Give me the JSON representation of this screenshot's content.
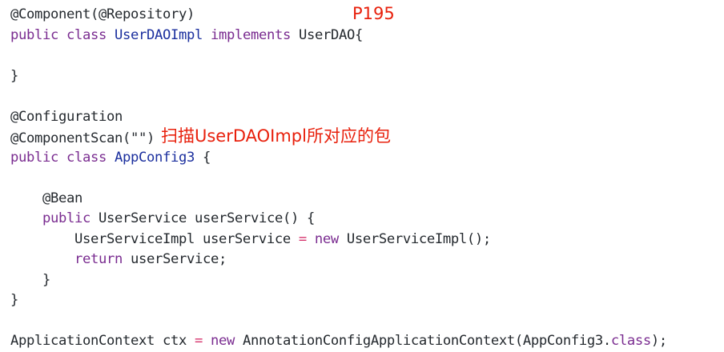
{
  "page_label": "P195",
  "annotation": "扫描UserDAOImpl所对应的包",
  "colors": {
    "plain": "#24292e",
    "keyword": "#7a2c90",
    "type": "#1b2f9e",
    "operator": "#d6336c",
    "annotation_text": "#e8200c",
    "string": "#24292e"
  },
  "lines": [
    [
      {
        "t": "@Component(@Repository)",
        "k": "plain"
      }
    ],
    [
      {
        "t": "public",
        "k": "keyword"
      },
      {
        "t": " ",
        "k": "plain"
      },
      {
        "t": "class",
        "k": "keyword"
      },
      {
        "t": " ",
        "k": "plain"
      },
      {
        "t": "UserDAOImpl",
        "k": "type"
      },
      {
        "t": " ",
        "k": "plain"
      },
      {
        "t": "implements",
        "k": "keyword"
      },
      {
        "t": " UserDAO{",
        "k": "plain"
      }
    ],
    [],
    [
      {
        "t": "}",
        "k": "plain"
      }
    ],
    [],
    [
      {
        "t": "@Configuration",
        "k": "plain"
      }
    ],
    [
      {
        "t": "@ComponentScan(",
        "k": "plain"
      },
      {
        "t": "\"\"",
        "k": "plain"
      },
      {
        "t": ")",
        "k": "plain"
      }
    ],
    [
      {
        "t": "public",
        "k": "keyword"
      },
      {
        "t": " ",
        "k": "plain"
      },
      {
        "t": "class",
        "k": "keyword"
      },
      {
        "t": " ",
        "k": "plain"
      },
      {
        "t": "AppConfig3",
        "k": "type"
      },
      {
        "t": " {",
        "k": "plain"
      }
    ],
    [],
    [
      {
        "t": "    @Bean",
        "k": "plain"
      }
    ],
    [
      {
        "t": "    ",
        "k": "plain"
      },
      {
        "t": "public",
        "k": "keyword"
      },
      {
        "t": " UserService userService() {",
        "k": "plain"
      }
    ],
    [
      {
        "t": "        UserServiceImpl userService ",
        "k": "plain"
      },
      {
        "t": "=",
        "k": "operator"
      },
      {
        "t": " ",
        "k": "plain"
      },
      {
        "t": "new",
        "k": "keyword"
      },
      {
        "t": " UserServiceImpl();",
        "k": "plain"
      }
    ],
    [
      {
        "t": "        ",
        "k": "plain"
      },
      {
        "t": "return",
        "k": "keyword"
      },
      {
        "t": " userService;",
        "k": "plain"
      }
    ],
    [
      {
        "t": "    }",
        "k": "plain"
      }
    ],
    [
      {
        "t": "}",
        "k": "plain"
      }
    ],
    [],
    [
      {
        "t": "ApplicationContext ctx ",
        "k": "plain"
      },
      {
        "t": "=",
        "k": "operator"
      },
      {
        "t": " ",
        "k": "plain"
      },
      {
        "t": "new",
        "k": "keyword"
      },
      {
        "t": " AnnotationConfigApplicationContext(AppConfig3.",
        "k": "plain"
      },
      {
        "t": "class",
        "k": "keyword"
      },
      {
        "t": ");",
        "k": "plain"
      }
    ]
  ]
}
